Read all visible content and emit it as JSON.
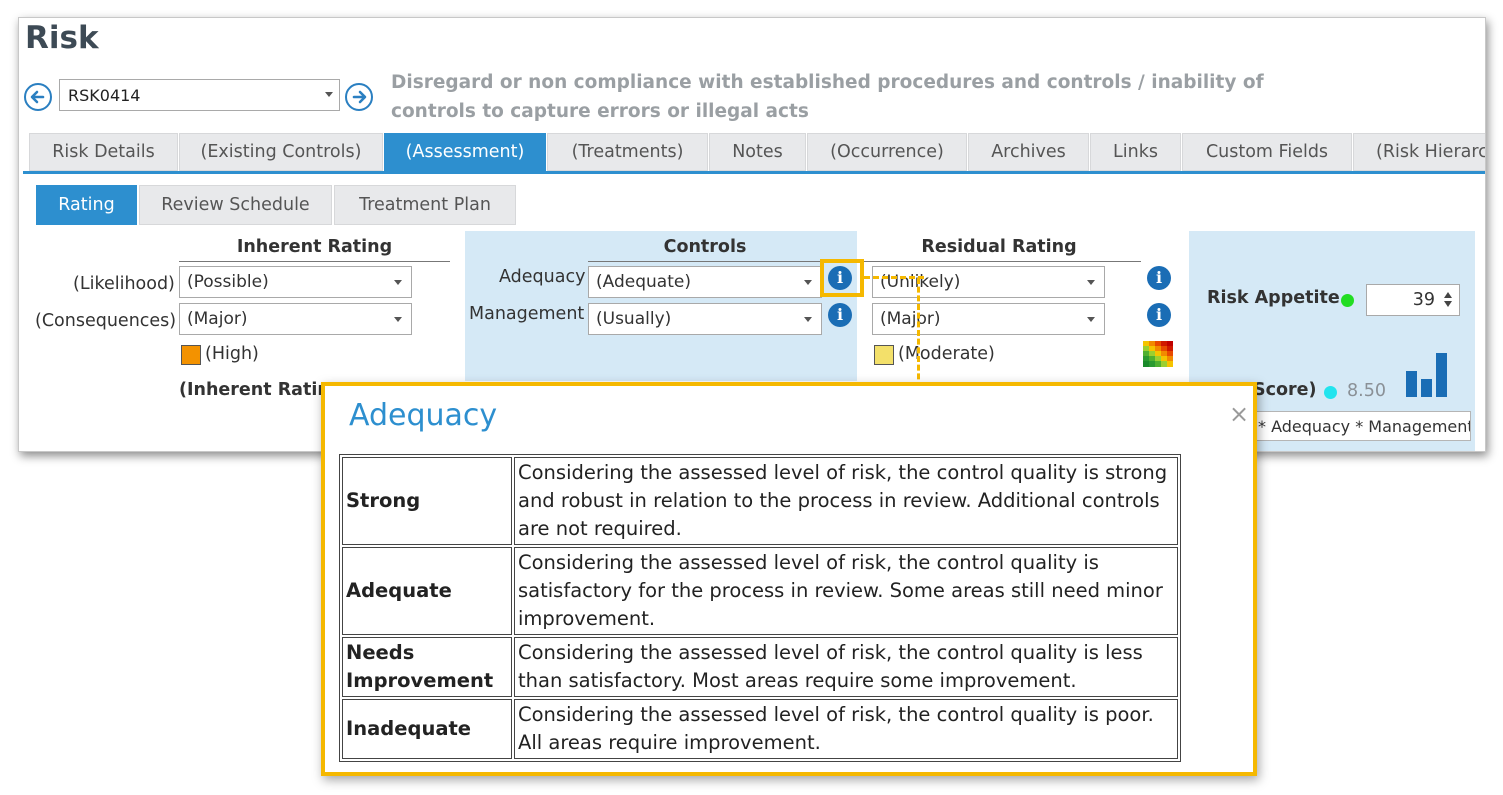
{
  "app": {
    "title": "Risk",
    "risk_id": "RSK0414",
    "risk_description": "Disregard or non compliance with established procedures and controls / inability of controls to capture errors or illegal acts"
  },
  "tabs": [
    {
      "label": "Risk Details",
      "active": false
    },
    {
      "label": "(Existing Controls)",
      "active": false
    },
    {
      "label": "(Assessment)",
      "active": true
    },
    {
      "label": "(Treatments)",
      "active": false
    },
    {
      "label": "Notes",
      "active": false
    },
    {
      "label": "(Occurrence)",
      "active": false
    },
    {
      "label": "Archives",
      "active": false
    },
    {
      "label": "Links",
      "active": false
    },
    {
      "label": "Custom Fields",
      "active": false
    },
    {
      "label": "(Risk Hierarc",
      "active": false
    }
  ],
  "subtabs": [
    {
      "label": "Rating",
      "active": true
    },
    {
      "label": "Review Schedule",
      "active": false
    },
    {
      "label": "Treatment Plan",
      "active": false
    }
  ],
  "inherent": {
    "title": "Inherent Rating",
    "likelihood_label": "(Likelihood)",
    "likelihood_value": "(Possible)",
    "consequences_label": "(Consequences)",
    "consequences_value": "(Major)",
    "rating_text": "(High)",
    "rating_color": "#f39200",
    "score_label": "(Inherent Rating"
  },
  "controls": {
    "title": "Controls",
    "adequacy_label": "Adequacy",
    "adequacy_value": "(Adequate)",
    "management_label": "Management",
    "management_value": "(Usually)"
  },
  "residual": {
    "title": "Residual Rating",
    "likelihood_value": "(Unlikely)",
    "consequences_value": "(Major)",
    "rating_text": "(Moderate)",
    "rating_color": "#f3e06a"
  },
  "appetite": {
    "label": "Risk Appetite",
    "value": "39",
    "score_label": "Score)",
    "score_value": "8.50",
    "formula": "* Adequacy * Management"
  },
  "icons": {
    "prev": "arrow-left-circle-icon",
    "next": "arrow-right-circle-icon",
    "info": "info-icon",
    "heatmap": "heatmap-icon",
    "chart": "bar-chart-icon",
    "close": "close-icon"
  },
  "popup": {
    "title": "Adequacy",
    "close": "×",
    "rows": [
      {
        "term": "Strong",
        "definition": "Considering the assessed level of risk, the control quality is strong and robust in relation to the process in review. Additional controls are not required."
      },
      {
        "term": "Adequate",
        "definition": "Considering the assessed level of risk, the control quality is satisfactory for the process in review. Some areas still need minor improvement."
      },
      {
        "term": "Needs Improvement",
        "definition": "Considering the assessed level of risk, the control quality is less than satisfactory. Most areas require some improvement."
      },
      {
        "term": "Inadequate",
        "definition": "Considering the assessed level of risk, the control quality is poor. All areas require improvement."
      }
    ]
  }
}
